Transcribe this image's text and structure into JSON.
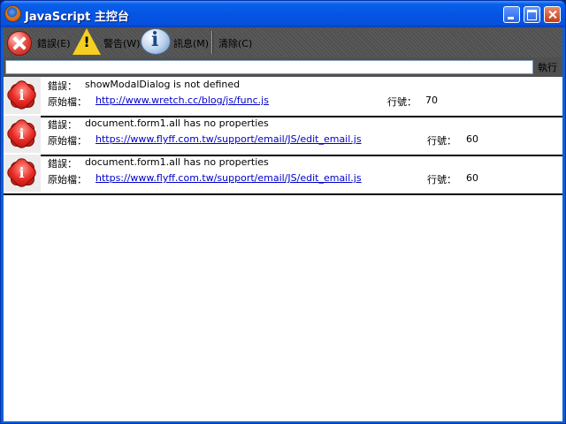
{
  "window": {
    "title": "JavaScript 主控台"
  },
  "toolbar": {
    "errors_label": "錯誤(E)",
    "warnings_label": "警告(W)",
    "messages_label": "訊息(M)",
    "clear_label": "清除(C)"
  },
  "command": {
    "value": "",
    "execute_label": "執行"
  },
  "entries": [
    {
      "error_label": "錯誤：",
      "message": "showModalDialog is not defined",
      "source_label": "原始檔：",
      "source_url": "http://www.wretch.cc/blog/js/func.js",
      "line_label": "行號：",
      "line": "70"
    },
    {
      "error_label": "錯誤：",
      "message": "document.form1.all has no properties",
      "source_label": "原始檔：",
      "source_url": "https://www.flyff.com.tw/support/email/JS/edit_email.js",
      "line_label": "行號：",
      "line": "60"
    },
    {
      "error_label": "錯誤：",
      "message": "document.form1.all has no properties",
      "source_label": "原始檔：",
      "source_url": "https://www.flyff.com.tw/support/email/JS/edit_email.js",
      "line_label": "行號：",
      "line": "60"
    }
  ],
  "icons": {
    "app": "firefox-icon",
    "errors": "error-icon",
    "warnings": "warning-icon",
    "messages": "info-icon",
    "entry": "error-icon"
  },
  "colors": {
    "titlebar": "#0554e3",
    "toolbar": "#505050",
    "link": "#0000cc",
    "error": "#e82a24"
  }
}
